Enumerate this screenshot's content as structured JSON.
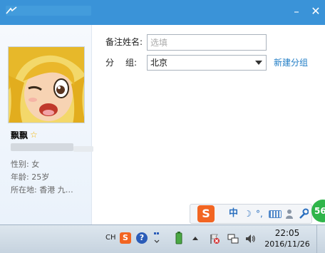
{
  "window": {
    "minimize_glyph": "–",
    "close_glyph": "✕"
  },
  "profile": {
    "nickname": "飘飘",
    "gender_line": "性别: 女",
    "age_line": "年龄: 25岁",
    "location_line": "所在地: 香港  九…",
    "star_icon": "star-icon",
    "star_color": "#f4b400"
  },
  "form": {
    "remark_label": "备注姓名:",
    "remark_placeholder": "选填",
    "group_label_a": "分",
    "group_label_b": "组:",
    "group_value": "北京",
    "new_group_link": "新建分组"
  },
  "ime": {
    "logo": "S",
    "mode": "中",
    "moon": "☽",
    "punct": "°,",
    "speed_badge": "56"
  },
  "taskbar": {
    "lang": "CH",
    "sogou": "S",
    "help": "?",
    "time": "22:05",
    "date": "2016/11/26"
  },
  "colors": {
    "titlebar": "#3a93d8",
    "link": "#1f7cc5",
    "sogou": "#f26522",
    "badge": "#2fb54a"
  }
}
